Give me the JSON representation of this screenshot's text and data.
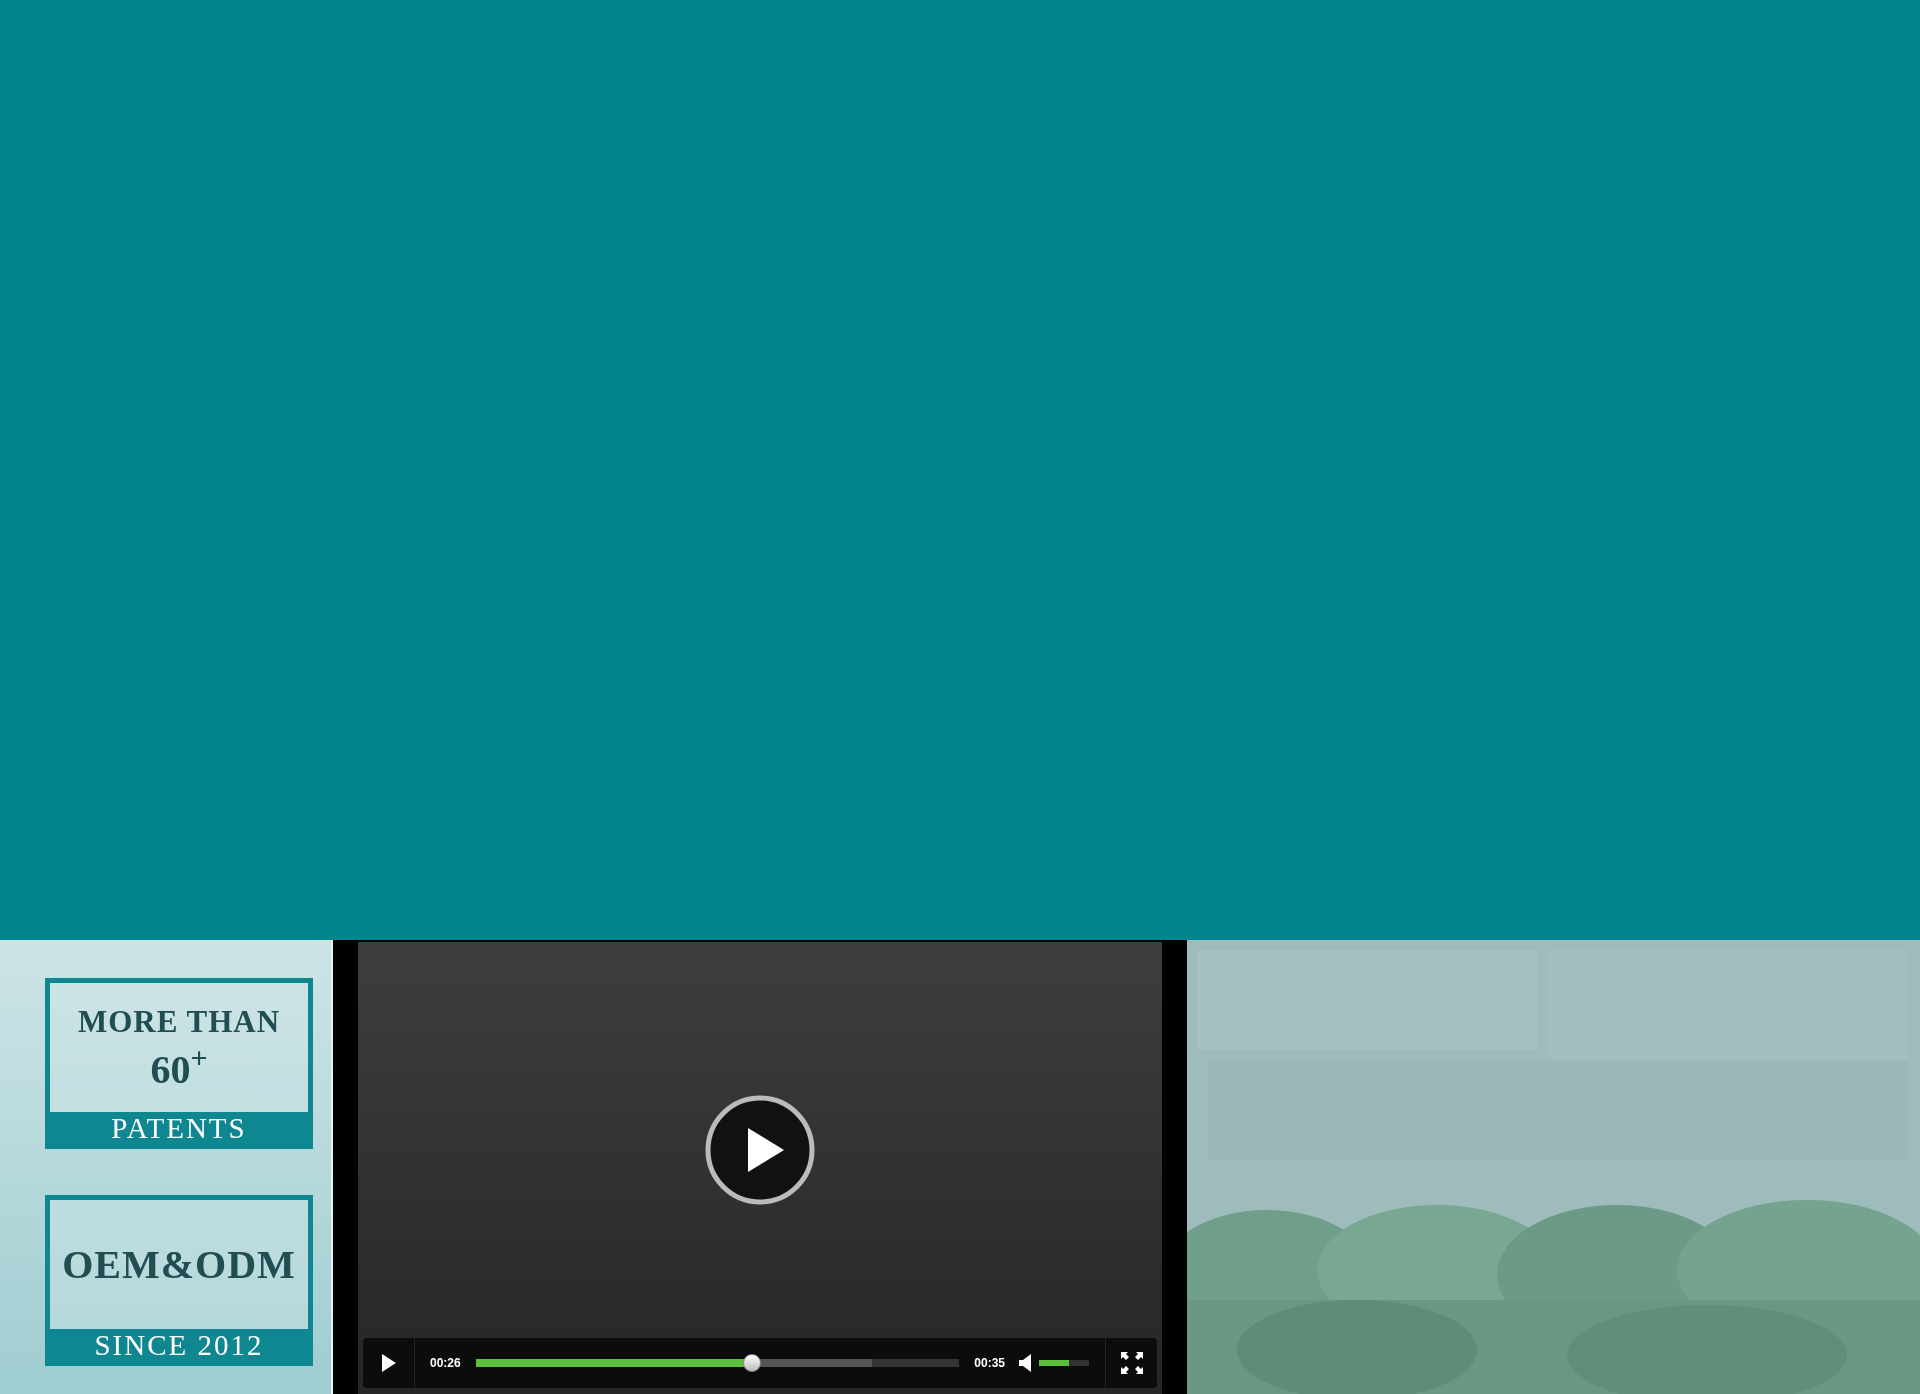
{
  "banner": {
    "cards": [
      {
        "lines": [
          "MORE THAN",
          "60$^{+}$"
        ],
        "footer": "PATENTS"
      },
      {
        "lines": [
          "OEM&ODM"
        ],
        "footer": "SINCE 2012"
      }
    ]
  },
  "video": {
    "playing": false,
    "current_time": "00:26",
    "duration": "00:35",
    "progress": {
      "level": 0.57
    },
    "volume": {
      "level": 0.6,
      "muted": false
    }
  }
}
